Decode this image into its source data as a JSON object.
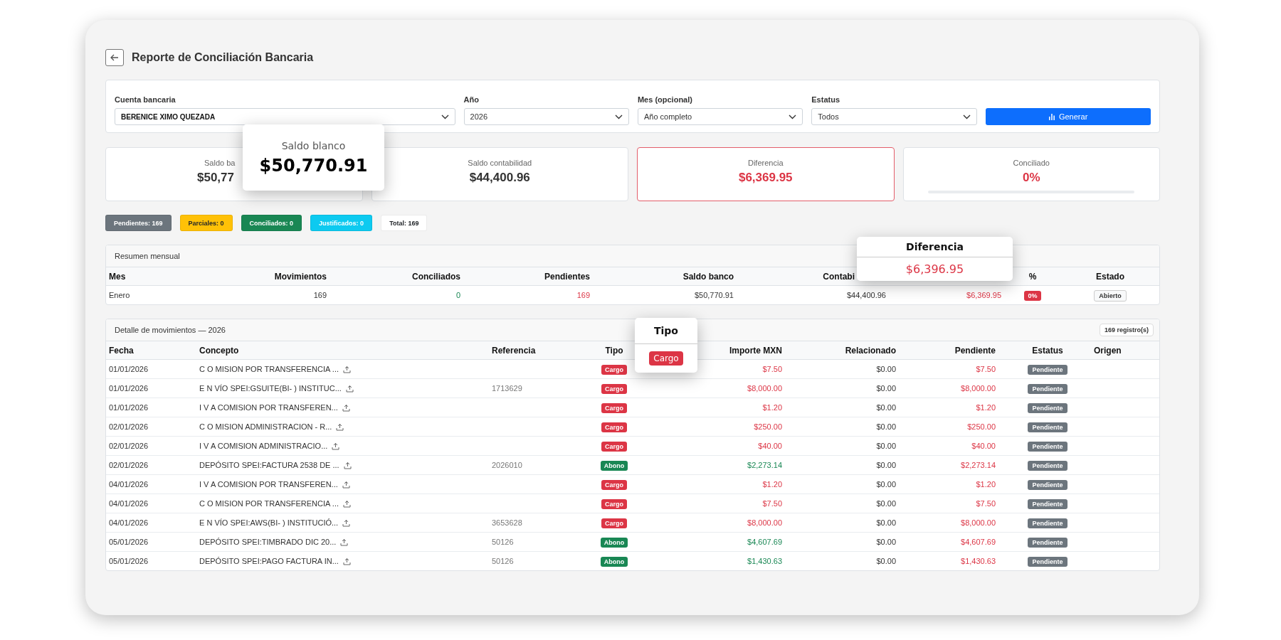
{
  "header": {
    "title": "Reporte de Conciliación Bancaria"
  },
  "filters": [
    {
      "label": "Cuenta bancaria",
      "value": "BERENICE XIMO QUEZADA",
      "kind": "wide"
    },
    {
      "label": "Año",
      "value": "2026",
      "kind": "normal"
    },
    {
      "label": "Mes (opcional)",
      "value": "Año completo",
      "kind": "normal"
    },
    {
      "label": "Estatus",
      "value": "Todos",
      "kind": "normal"
    }
  ],
  "generate_button": "Generar",
  "cards": [
    {
      "label": "Saldo ba",
      "value": "$50,77",
      "highlighted": false,
      "negative": false
    },
    {
      "label": "Saldo contabilidad",
      "value": "$44,400.96",
      "highlighted": false,
      "negative": false
    },
    {
      "label": "Diferencia",
      "value": "$6,369.95",
      "highlighted": true,
      "negative": true
    },
    {
      "label": "Conciliado",
      "value": "0%",
      "highlighted": false,
      "negative": true,
      "level": 0
    }
  ],
  "status_badges": [
    {
      "label": "Pendientes: 169",
      "color": "#6c757d"
    },
    {
      "label": "Parciales: 0",
      "color": "#ffc107"
    },
    {
      "label": "Conciliados: 0",
      "color": "#198754"
    },
    {
      "label": "Justificados: 0",
      "color": "#0dcaf0"
    },
    {
      "label": "Total: 169",
      "color": "#ffffff"
    }
  ],
  "summary": {
    "title": "Resumen mensual",
    "columns": [
      "Mes",
      "Movimientos",
      "Conciliados",
      "Pendientes",
      "Saldo banco",
      "Contabi",
      "",
      "%",
      "Estado"
    ],
    "rows": [
      {
        "mes": "Enero",
        "movimientos": "169",
        "conciliados": "0",
        "pendientes": "169",
        "saldo_banco": "$50,770.91",
        "contabilidad": "$44,400.96",
        "diferencia": "$6,369.95",
        "porcentaje": "0%",
        "estado": "Abierto"
      }
    ]
  },
  "detail": {
    "title": "Detalle de movimientos — 2026",
    "count": "169 registro(s)",
    "columns": [
      "Fecha",
      "Concepto",
      "Referencia",
      "Tipo",
      "Importe MXN",
      "Relacionado",
      "Pendiente",
      "Estatus",
      "Origen"
    ],
    "rows": [
      {
        "fecha": "01/01/2026",
        "concepto": "C O MISION POR TRANSFERENCIA ...",
        "referencia": "",
        "tipo": "Cargo",
        "kind": "cargo",
        "importe": "$7.50",
        "relacionado": "$0.00",
        "pendiente": "$7.50",
        "estatus": "Pendiente"
      },
      {
        "fecha": "01/01/2026",
        "concepto": "E N VÍO SPEI:GSUITE(BI- ) INSTITUC...",
        "referencia": "1713629",
        "tipo": "Cargo",
        "kind": "cargo",
        "importe": "$8,000.00",
        "relacionado": "$0.00",
        "pendiente": "$8,000.00",
        "estatus": "Pendiente"
      },
      {
        "fecha": "01/01/2026",
        "concepto": "I V A COMISION POR TRANSFEREN...",
        "referencia": "",
        "tipo": "Cargo",
        "kind": "cargo",
        "importe": "$1.20",
        "relacionado": "$0.00",
        "pendiente": "$1.20",
        "estatus": "Pendiente"
      },
      {
        "fecha": "02/01/2026",
        "concepto": "C O MISION ADMINISTRACION - R...",
        "referencia": "",
        "tipo": "Cargo",
        "kind": "cargo",
        "importe": "$250.00",
        "relacionado": "$0.00",
        "pendiente": "$250.00",
        "estatus": "Pendiente"
      },
      {
        "fecha": "02/01/2026",
        "concepto": "I V A COMISION ADMINISTRACIO...",
        "referencia": "",
        "tipo": "Cargo",
        "kind": "cargo",
        "importe": "$40.00",
        "relacionado": "$0.00",
        "pendiente": "$40.00",
        "estatus": "Pendiente"
      },
      {
        "fecha": "02/01/2026",
        "concepto": "DEPÓSITO SPEI:FACTURA 2538 DE ...",
        "referencia": "2026010",
        "tipo": "Abono",
        "kind": "abono",
        "importe": "$2,273.14",
        "relacionado": "$0.00",
        "pendiente": "$2,273.14",
        "estatus": "Pendiente"
      },
      {
        "fecha": "04/01/2026",
        "concepto": "I V A COMISION POR TRANSFEREN...",
        "referencia": "",
        "tipo": "Cargo",
        "kind": "cargo",
        "importe": "$1.20",
        "relacionado": "$0.00",
        "pendiente": "$1.20",
        "estatus": "Pendiente"
      },
      {
        "fecha": "04/01/2026",
        "concepto": "C O MISION POR TRANSFERENCIA ...",
        "referencia": "",
        "tipo": "Cargo",
        "kind": "cargo",
        "importe": "$7.50",
        "relacionado": "$0.00",
        "pendiente": "$7.50",
        "estatus": "Pendiente"
      },
      {
        "fecha": "04/01/2026",
        "concepto": "E N VÍO SPEI:AWS(BI- ) INSTITUCIÓ...",
        "referencia": "3653628",
        "tipo": "Cargo",
        "kind": "cargo",
        "importe": "$8,000.00",
        "relacionado": "$0.00",
        "pendiente": "$8,000.00",
        "estatus": "Pendiente"
      },
      {
        "fecha": "05/01/2026",
        "concepto": "DEPÓSITO SPEI:TIMBRADO DIC 20...",
        "referencia": "50126",
        "tipo": "Abono",
        "kind": "abono",
        "importe": "$4,607.69",
        "relacionado": "$0.00",
        "pendiente": "$4,607.69",
        "estatus": "Pendiente"
      },
      {
        "fecha": "05/01/2026",
        "concepto": "DEPÓSITO SPEI:PAGO FACTURA IN...",
        "referencia": "50126",
        "tipo": "Abono",
        "kind": "abono",
        "importe": "$1,430.63",
        "relacionado": "$0.00",
        "pendiente": "$1,430.63",
        "estatus": "Pendiente"
      }
    ]
  },
  "callouts": [
    {
      "kind": "value",
      "title": "Saldo blanco",
      "value": "$50,770.91"
    },
    {
      "kind": "header",
      "title": "Diferencia",
      "value": "$6,396.95"
    },
    {
      "kind": "badge",
      "title": "Tipo",
      "value": "Cargo"
    }
  ]
}
